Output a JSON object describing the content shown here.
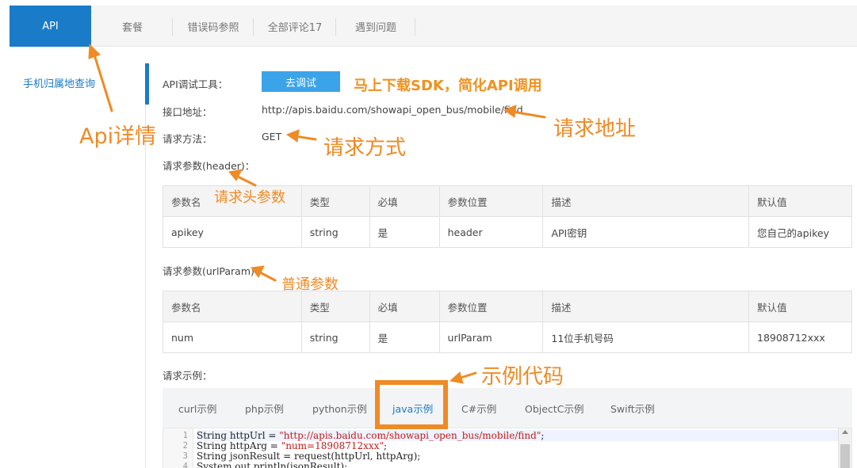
{
  "tabs": {
    "api": "API",
    "items": [
      "套餐",
      "错误码参照",
      "全部评论17",
      "遇到问题"
    ]
  },
  "sidebar": {
    "items": [
      {
        "label": "手机归属地查询"
      }
    ]
  },
  "form": {
    "debug_label": "API调试工具：",
    "debug_button": "去调试",
    "address_label": "接口地址：",
    "address_value": "http://apis.baidu.com/showapi_open_bus/mobile/find",
    "method_label": "请求方法：",
    "method_value": "GET",
    "header_params_label": "请求参数(header)：",
    "url_params_label": "请求参数(urlParam)：",
    "example_label": "请求示例："
  },
  "columns": [
    "参数名",
    "类型",
    "必填",
    "参数位置",
    "描述",
    "默认值"
  ],
  "header_table": {
    "rows": [
      [
        "apikey",
        "string",
        "是",
        "header",
        "API密钥",
        "您自己的apikey"
      ]
    ]
  },
  "url_table": {
    "rows": [
      [
        "num",
        "string",
        "是",
        "urlParam",
        "11位手机号码",
        "18908712xxx"
      ]
    ]
  },
  "code_tabs": [
    "curl示例",
    "php示例",
    "python示例",
    "java示例",
    "C#示例",
    "ObjectC示例",
    "Swift示例"
  ],
  "code_tabs_active": "java示例",
  "code": {
    "line_numbers": [
      "1",
      "2",
      "3",
      "4"
    ],
    "line1_prefix": "String httpUrl = ",
    "line1_str": "\"http://apis.baidu.com/showapi_open_bus/mobile/find\"",
    "line1_suffix": ";",
    "line2_prefix": "String httpArg = ",
    "line2_str": "\"num=18908712xxx\"",
    "line2_suffix": ";",
    "line3": "String jsonResult = request(httpUrl, httpArg);",
    "line4": "System.out.println(jsonResult);"
  },
  "annotations": {
    "api_detail": "Api详情",
    "sdk": "马上下载SDK，简化API调用",
    "address": "请求地址",
    "method": "请求方式",
    "header_params": "请求头参数",
    "normal_params": "普通参数",
    "example_code": "示例代码"
  },
  "colors": {
    "accent": "#1a7bc8",
    "button": "#3ba3e8",
    "annotation": "#f08a24"
  }
}
